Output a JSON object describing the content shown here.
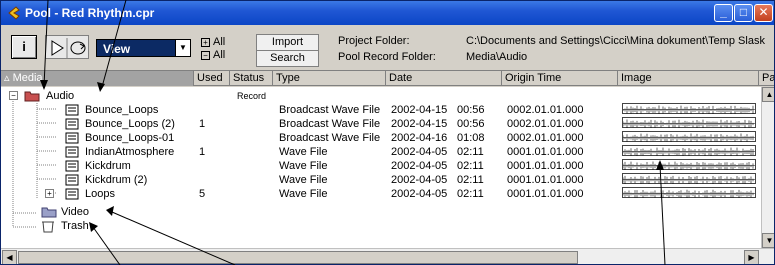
{
  "window": {
    "title": "Pool - Red Rhythm.cpr",
    "minimize_label": "_",
    "maximize_label": "□",
    "close_label": "✕"
  },
  "toolbar": {
    "info_label": "i",
    "view_label": "View",
    "all_1": "All",
    "all_2": "All",
    "import_label": "Import",
    "search_label": "Search",
    "project_folder_label": "Project Folder:",
    "pool_record_folder_label": "Pool Record Folder:",
    "project_folder_value": "C:\\Documents and Settings\\Cicci\\Mina dokument\\Temp Slask",
    "pool_record_folder_value": "Media\\Audio"
  },
  "columns": [
    "Media",
    "Used",
    "Status",
    "Type",
    "Date",
    "Origin Time",
    "Image",
    "Path"
  ],
  "audio_folder": {
    "name": "Audio",
    "status": "Record"
  },
  "files": [
    {
      "name": "Bounce_Loops",
      "used": "",
      "type": "Broadcast Wave File",
      "date": "2002-04-15",
      "time": "00:56",
      "origin": "0002.01.01.000"
    },
    {
      "name": "Bounce_Loops (2)",
      "used": "1",
      "type": "Broadcast Wave File",
      "date": "2002-04-15",
      "time": "00:56",
      "origin": "0002.01.01.000"
    },
    {
      "name": "Bounce_Loops-01",
      "used": "",
      "type": "Broadcast Wave File",
      "date": "2002-04-16",
      "time": "01:08",
      "origin": "0002.01.01.000"
    },
    {
      "name": "IndianAtmosphere",
      "used": "1",
      "type": "Wave File",
      "date": "2002-04-05",
      "time": "02:11",
      "origin": "0001.01.01.000"
    },
    {
      "name": "Kickdrum",
      "used": "",
      "type": "Wave File",
      "date": "2002-04-05",
      "time": "02:11",
      "origin": "0001.01.01.000"
    },
    {
      "name": "Kickdrum (2)",
      "used": "",
      "type": "Wave File",
      "date": "2002-04-05",
      "time": "02:11",
      "origin": "0001.01.01.000"
    },
    {
      "name": "Loops",
      "used": "5",
      "type": "Wave File",
      "date": "2002-04-05",
      "time": "02:11",
      "origin": "0001.01.01.000"
    }
  ],
  "video_folder": {
    "name": "Video"
  },
  "trash_folder": {
    "name": "Trash"
  }
}
